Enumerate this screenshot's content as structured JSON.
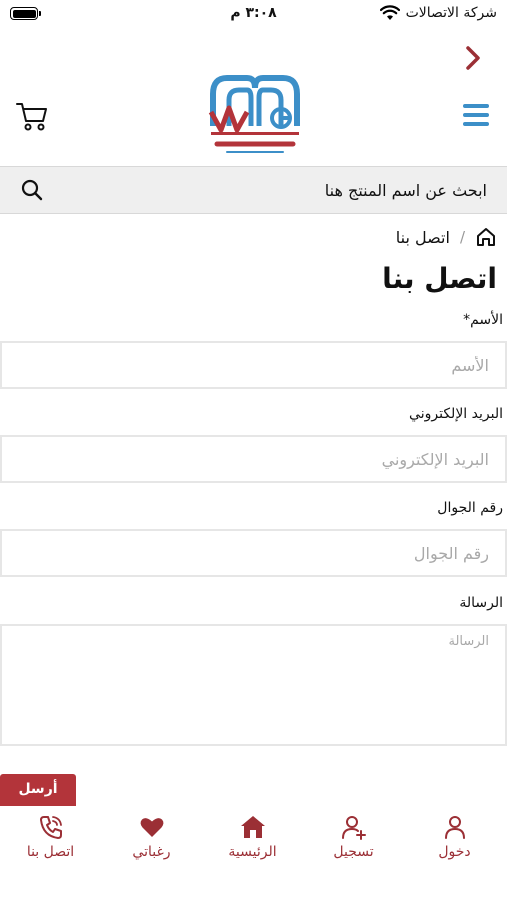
{
  "status_bar": {
    "carrier": "شركة الاتصالات",
    "time": "٣:٠٨ م"
  },
  "header": {
    "back_icon": "chevron-right-icon",
    "logo_icon": "warranty-gate-logo",
    "cart_icon": "cart-icon",
    "menu_icon": "hamburger-menu-icon"
  },
  "search": {
    "placeholder": "ابحث عن اسم المنتج هنا",
    "icon": "search-icon"
  },
  "breadcrumb": {
    "home_icon": "home-icon",
    "separator": "/",
    "current": "اتصل بنا"
  },
  "page": {
    "title": "اتصل بنا"
  },
  "form": {
    "name": {
      "label": "الأسم*",
      "placeholder": "الأسم"
    },
    "email": {
      "label": "البريد الإلكتروني",
      "placeholder": "البريد الإلكتروني"
    },
    "phone": {
      "label": "رقم الجوال",
      "placeholder": "رقم الجوال"
    },
    "message": {
      "label": "الرسالة",
      "placeholder": "الرسالة"
    },
    "submit_label": "أرسل"
  },
  "bottom_nav": {
    "items": [
      {
        "label": "اتصل بنا",
        "icon": "phone-icon"
      },
      {
        "label": "رغباتي",
        "icon": "heart-icon"
      },
      {
        "label": "الرئيسية",
        "icon": "home-icon"
      },
      {
        "label": "تسجيل",
        "icon": "user-plus-icon"
      },
      {
        "label": "دخول",
        "icon": "user-icon"
      }
    ]
  },
  "colors": {
    "brand_red": "#b3343a",
    "brand_blue": "#3c8fc8",
    "search_bg": "#efefef"
  }
}
